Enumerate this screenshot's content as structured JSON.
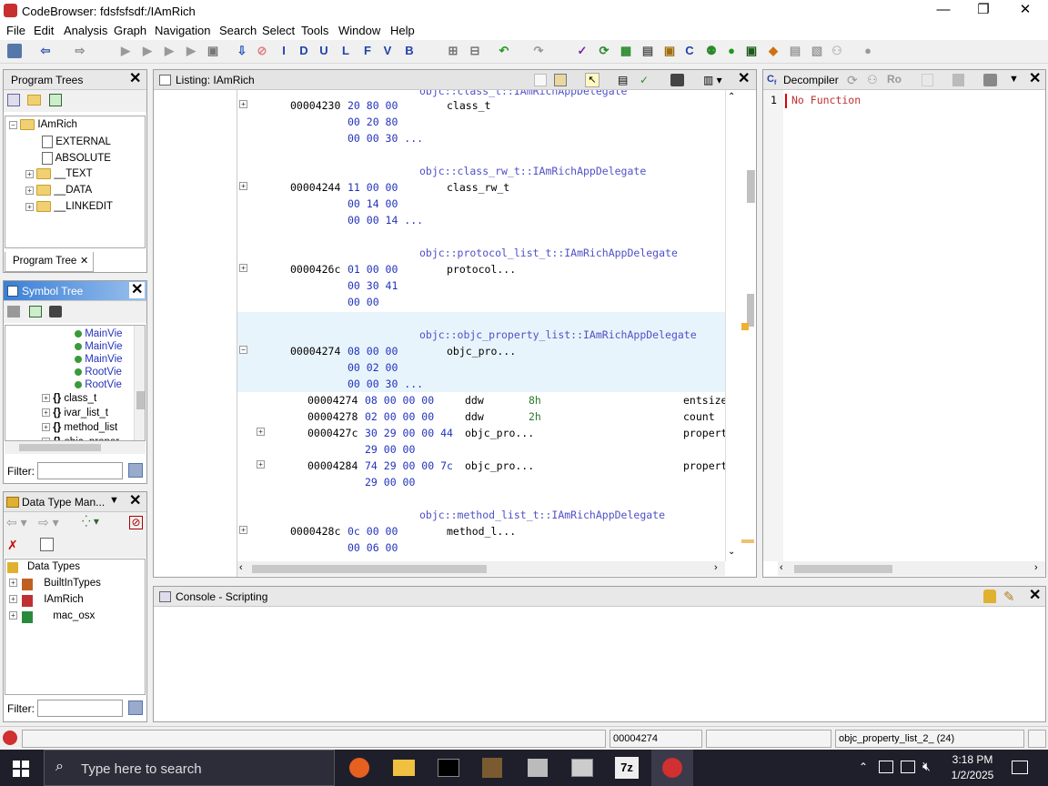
{
  "window": {
    "title": "CodeBrowser: fdsfsfsdf:/IAmRich",
    "min": "—",
    "max": "❐",
    "close": "✕"
  },
  "menu": [
    "File",
    "Edit",
    "Analysis",
    "Graph",
    "Navigation",
    "Search",
    "Select",
    "Tools",
    "Window",
    "Help"
  ],
  "program_trees": {
    "title": "Program Trees",
    "root": "IAmRich",
    "items": [
      "EXTERNAL",
      "ABSOLUTE",
      "__TEXT",
      "__DATA",
      "__LINKEDIT"
    ],
    "tab": "Program Tree"
  },
  "symbol_tree": {
    "title": "Symbol Tree",
    "leaves": [
      "MainVie",
      "MainVie",
      "MainVie",
      "RootVie",
      "RootVie"
    ],
    "nodes": [
      "class_t",
      "ivar_list_t",
      "method_list",
      "objc_proper"
    ],
    "filter_label": "Filter:"
  },
  "data_types": {
    "title": "Data Type Man...",
    "root": "Data Types",
    "items": [
      "BuiltInTypes",
      "IAmRich",
      "mac_osx"
    ],
    "filter_label": "Filter:"
  },
  "listing": {
    "title": "Listing:  IAmRich",
    "top_label": "objc::class_t::IAmRichAppDelegate",
    "blocks": [
      {
        "addr": "00004230",
        "bytes": [
          "20 80 00",
          "00 20 80",
          "00 00 30 ..."
        ],
        "mnem": "class_t"
      },
      {
        "label": "objc::class_rw_t::IAmRichAppDelegate",
        "addr": "00004244",
        "bytes": [
          "11 00 00",
          "00 14 00",
          "00 00 14 ..."
        ],
        "mnem": "class_rw_t"
      },
      {
        "label": "objc::protocol_list_t::IAmRichAppDelegate",
        "addr": "0000426c",
        "bytes": [
          "01 00 00",
          "00 30 41",
          "00 00"
        ],
        "mnem": "protocol..."
      },
      {
        "label": "objc::objc_property_list::IAmRichAppDelegate",
        "addr": "00004274",
        "bytes": [
          "08 00 00",
          "00 02 00",
          "00 00 30 ..."
        ],
        "mnem": "objc_pro..."
      }
    ],
    "fields": [
      {
        "addr": "00004274",
        "bytes": "08 00 00 00",
        "mnem": "ddw",
        "val": "8h",
        "name": "entsize"
      },
      {
        "addr": "00004278",
        "bytes": "02 00 00 00",
        "mnem": "ddw",
        "val": "2h",
        "name": "count"
      },
      {
        "addr": "0000427c",
        "bytes": "30 29 00 00 44",
        "bytes2": "29 00 00",
        "mnem": "objc_pro...",
        "val": "",
        "name": "propert"
      },
      {
        "addr": "00004284",
        "bytes": "74 29 00 00 7c",
        "bytes2": "29 00 00",
        "mnem": "objc_pro...",
        "val": "",
        "name": "propert"
      }
    ],
    "last": {
      "label": "objc::method_list_t::IAmRichAppDelegate",
      "addr": "0000428c",
      "bytes": [
        "0c 00 00",
        "00 06 00"
      ],
      "mnem": "method_l..."
    }
  },
  "decompiler": {
    "title": "Decompiler",
    "line_no": "1",
    "text": "No Function",
    "ro": "Ro"
  },
  "console": {
    "title": "Console - Scripting"
  },
  "status": {
    "address": "00004274",
    "symbol": "objc_property_list_2_  (24)"
  },
  "taskbar": {
    "search": "Type here to search",
    "time": "3:18 PM",
    "date": "1/2/2025"
  }
}
